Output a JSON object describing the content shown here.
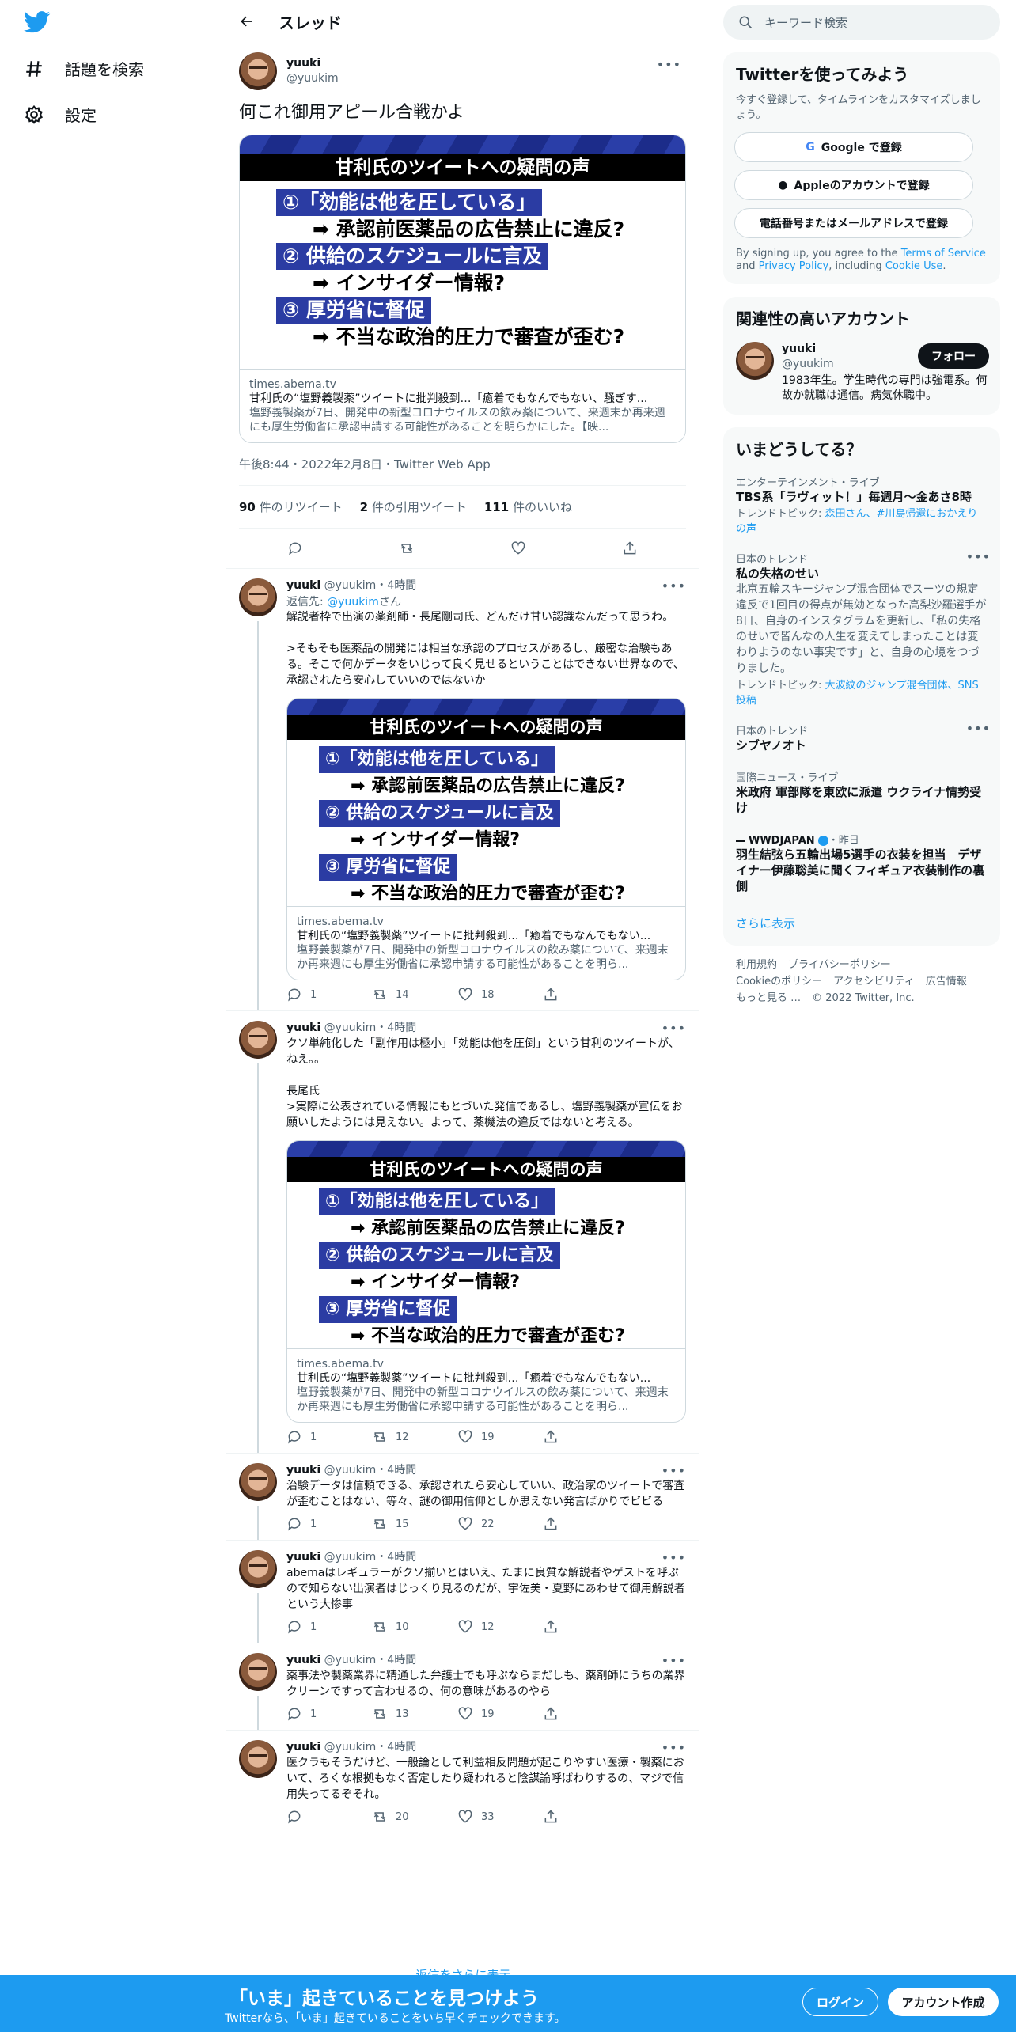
{
  "nav": {
    "explore": "話題を検索",
    "settings": "設定"
  },
  "header": {
    "title": "スレッド"
  },
  "main_tweet": {
    "name": "yuuki",
    "handle": "@yuukim",
    "text": "何これ御用アピール合戦かよ",
    "time": "午後8:44・2022年2月8日・Twitter Web App",
    "retweets_count": "90",
    "retweets_label": " 件のリツイート",
    "quotes_count": "2",
    "quotes_label": " 件の引用ツイート",
    "likes_count": "111",
    "likes_label": " 件のいいね"
  },
  "card": {
    "image_title": "甘利氏のツイートへの疑問の声",
    "item1": "①「効能は他を圧している」",
    "item1_sub": "➡ 承認前医薬品の広告禁止に違反?",
    "item2": "② 供給のスケジュールに言及",
    "item2_sub": "➡ インサイダー情報?",
    "item3": "③ 厚労省に督促",
    "item3_sub": "➡ 不当な政治的圧力で審査が歪む?",
    "domain": "times.abema.tv",
    "title": "甘利氏の“塩野義製薬”ツイートに批判殺到…「癒着でもなんでもない、騒ぎす...",
    "desc": "塩野義製薬が7日、開発中の新型コロナウイルスの飲み薬について、来週末か再来週にも厚生労働省に承認申請する可能性があることを明らかにした。【映..."
  },
  "replies": [
    {
      "name": "yuuki",
      "handle": "@yuukim",
      "time": "・4時間",
      "reply_to_prefix": "返信先: ",
      "reply_to_handle": "@yuukim",
      "reply_to_suffix": "さん",
      "text": "解説者枠で出演の薬剤師・長尾剛司氏、どんだけ甘い認識なんだって思うわ。\n\n>そもそも医薬品の開発には相当な承認のプロセスがあるし、厳密な治験もある。そこで何かデータをいじって良く見せるということはできない世界なので、承認されたら安心していいのではないか",
      "card_title": "甘利氏の“塩野義製薬”ツイートに批判殺到…「癒着でもなんでもない...",
      "card_desc": "塩野義製薬が7日、開発中の新型コロナウイルスの飲み薬について、来週末か再来週にも厚生労働省に承認申請する可能性があることを明ら...",
      "replies": "1",
      "retweets": "14",
      "likes": "18"
    },
    {
      "name": "yuuki",
      "handle": "@yuukim",
      "time": "・4時間",
      "text": "クソ単純化した「副作用は極小」「効能は他を圧倒」という甘利のツイートが、ねえ。。\n\n長尾氏\n>実際に公表されている情報にもとづいた発信であるし、塩野義製薬が宣伝をお願いしたようには見えない。よって、薬機法の違反ではないと考える。",
      "card_title": "甘利氏の“塩野義製薬”ツイートに批判殺到…「癒着でもなんでもない...",
      "card_desc": "塩野義製薬が7日、開発中の新型コロナウイルスの飲み薬について、来週末か再来週にも厚生労働省に承認申請する可能性があることを明ら...",
      "replies": "1",
      "retweets": "12",
      "likes": "19"
    },
    {
      "name": "yuuki",
      "handle": "@yuukim",
      "time": "・4時間",
      "text": "治験データは信頼できる、承認されたら安心していい、政治家のツイートで審査が歪むことはない、等々、謎の御用信仰としか思えない発言ばかりでビビる",
      "replies": "1",
      "retweets": "15",
      "likes": "22"
    },
    {
      "name": "yuuki",
      "handle": "@yuukim",
      "time": "・4時間",
      "text": "abemaはレギュラーがクソ揃いとはいえ、たまに良質な解説者やゲストを呼ぶので知らない出演者はじっくり見るのだが、宇佐美・夏野にあわせて御用解説者という大惨事",
      "replies": "1",
      "retweets": "10",
      "likes": "12"
    },
    {
      "name": "yuuki",
      "handle": "@yuukim",
      "time": "・4時間",
      "text": "薬事法や製薬業界に精通した弁護士でも呼ぶならまだしも、薬剤師にうちの業界クリーンですって言わせるの、何の意味があるのやら",
      "replies": "1",
      "retweets": "13",
      "likes": "19"
    },
    {
      "name": "yuuki",
      "handle": "@yuukim",
      "time": "・4時間",
      "text": "医クラもそうだけど、一般論として利益相反問題が起こりやすい医療・製薬において、ろくな根拠もなく否定したり疑われると陰謀論呼ばわりするの、マジで信用失ってるぞそれ。",
      "replies": "",
      "retweets": "20",
      "likes": "33"
    }
  ],
  "show_more": "返信をさらに表示",
  "search": {
    "placeholder": "キーワード検索"
  },
  "signup": {
    "title": "Twitterを使ってみよう",
    "subtitle": "今すぐ登録して、タイムラインをカスタマイズしましょう。",
    "google": "Google で登録",
    "apple": "Appleのアカウントで登録",
    "phone": "電話番号またはメールアドレスで登録",
    "terms_prefix": "By signing up, you agree to the ",
    "terms_tos": "Terms of Service",
    "terms_and": " and ",
    "terms_privacy": "Privacy Policy",
    "terms_including": ", including ",
    "terms_cookie": "Cookie Use",
    "terms_end": "."
  },
  "related": {
    "title": "関連性の高いアカウント",
    "name": "yuuki",
    "handle": "@yuukim",
    "follow": "フォロー",
    "bio": "1983年生。学生時代の専門は強電系。何故か就職は通信。病気休職中。"
  },
  "trends": {
    "title": "いまどうしてる？",
    "items": [
      {
        "cat": "エンターテインメント・ライブ",
        "name": "TBS系「ラヴィット！」毎週月〜金あさ8時",
        "sub_label": "トレンドトピック: ",
        "sub_links": "森田さん、#川島帰還におかえりの声"
      },
      {
        "cat": "日本のトレンド",
        "name": "私の失格のせい",
        "desc": "北京五輪スキージャンプ混合団体でスーツの規定違反で1回目の得点が無効となった高梨沙羅選手が8日、自身のインスタグラムを更新し、「私の失格のせいで皆んなの人生を変えてしまったことは変わりようのない事実です」と、自身の心境をつづりました。",
        "sub_label": "トレンドトピック: ",
        "sub_links": "大波紋のジャンプ混合団体、SNS投稿"
      },
      {
        "cat": "日本のトレンド",
        "name": "シブヤノオト"
      },
      {
        "cat": "国際ニュース・ライブ",
        "name": "米政府 軍部隊を東欧に派遣 ウクライナ情勢受け"
      },
      {
        "cat": "WWDJAPAN",
        "time": "・昨日",
        "name": "羽生結弦ら五輪出場5選手の衣装を担当　デザイナー伊藤聡美に聞くフィギュア衣装制作の裏側"
      }
    ],
    "show_more": "さらに表示"
  },
  "footer": {
    "terms": "利用規約",
    "privacy": "プライバシーポリシー",
    "cookie": "Cookieのポリシー",
    "accessibility": "アクセシビリティ",
    "ads": "広告情報",
    "more": "もっと見る …",
    "copyright": "© 2022 Twitter, Inc."
  },
  "banner": {
    "title": "「いま」起きていることを見つけよう",
    "subtitle": "Twitterなら、「いま」起きていることをいち早くチェックできます。",
    "login": "ログイン",
    "signup": "アカウント作成"
  },
  "colors": {
    "accent": "#1d9bf0",
    "text": "#0f1419",
    "secondary": "#536471",
    "card_blue": "#2b3ca3"
  }
}
